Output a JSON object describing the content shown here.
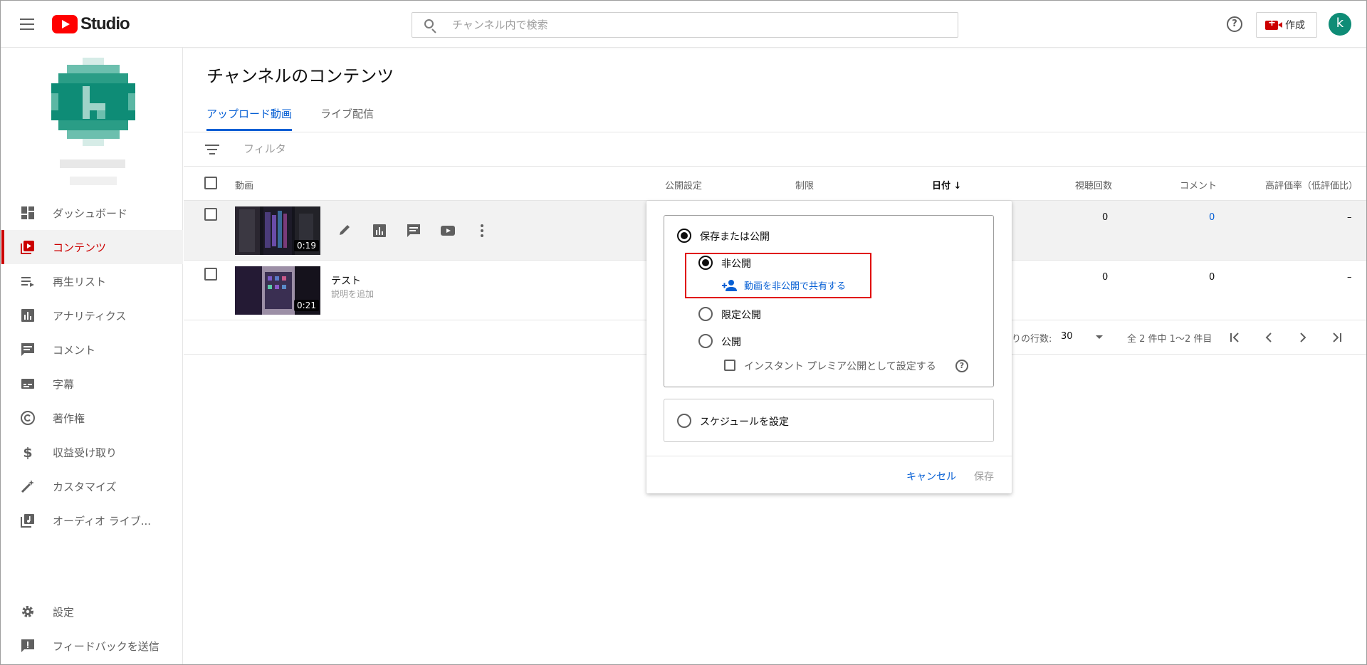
{
  "app": {
    "logo_text": "Studio"
  },
  "search": {
    "placeholder": "チャンネル内で検索"
  },
  "header": {
    "create_label": "作成",
    "avatar_letter": "k"
  },
  "sidebar": {
    "items": [
      {
        "label": "ダッシュボード",
        "icon": "dashboard-icon"
      },
      {
        "label": "コンテンツ",
        "icon": "content-icon",
        "active": true
      },
      {
        "label": "再生リスト",
        "icon": "playlist-icon"
      },
      {
        "label": "アナリティクス",
        "icon": "analytics-icon"
      },
      {
        "label": "コメント",
        "icon": "comment-icon"
      },
      {
        "label": "字幕",
        "icon": "subtitles-icon"
      },
      {
        "label": "著作権",
        "icon": "copyright-icon"
      },
      {
        "label": "収益受け取り",
        "icon": "dollar-icon"
      },
      {
        "label": "カスタマイズ",
        "icon": "magic-wand-icon"
      },
      {
        "label": "オーディオ ライブ...",
        "icon": "audio-library-icon"
      }
    ],
    "bottom": [
      {
        "label": "設定",
        "icon": "gear-icon"
      },
      {
        "label": "フィードバックを送信",
        "icon": "feedback-icon"
      }
    ]
  },
  "main": {
    "title": "チャンネルのコンテンツ",
    "tabs": [
      {
        "label": "アップロード動画",
        "active": true
      },
      {
        "label": "ライブ配信"
      }
    ],
    "filter_placeholder": "フィルタ",
    "columns": {
      "video": "動画",
      "visibility": "公開設定",
      "restrictions": "制限",
      "date": "日付 ↓",
      "views": "視聴回数",
      "comments": "コメント",
      "likes": "高評価率（低評価比）"
    },
    "rows": [
      {
        "duration": "0:19",
        "title": "",
        "description": "",
        "views": "0",
        "comments": "0",
        "likes": "–"
      },
      {
        "duration": "0:21",
        "title": "テスト",
        "description": "説明を追加",
        "views": "0",
        "comments": "0",
        "likes": "–"
      }
    ],
    "pager": {
      "rows_per_page_label": "りの行数:",
      "rows_per_page": "30",
      "range": "全 2 件中 1～2 件目"
    }
  },
  "popup": {
    "save_or_publish": "保存または公開",
    "private": "非公開",
    "share_private": "動画を非公開で共有する",
    "unlisted": "限定公開",
    "public": "公開",
    "instant_premiere": "インスタント プレミア公開として設定する",
    "schedule": "スケジュールを設定",
    "cancel": "キャンセル",
    "save": "保存"
  },
  "colors": {
    "accent_blue": "#065fd4",
    "brand_red": "#ff0000",
    "active_red": "#cc0000",
    "avatar_green": "#0e8c76",
    "highlight_red": "#e00000"
  }
}
